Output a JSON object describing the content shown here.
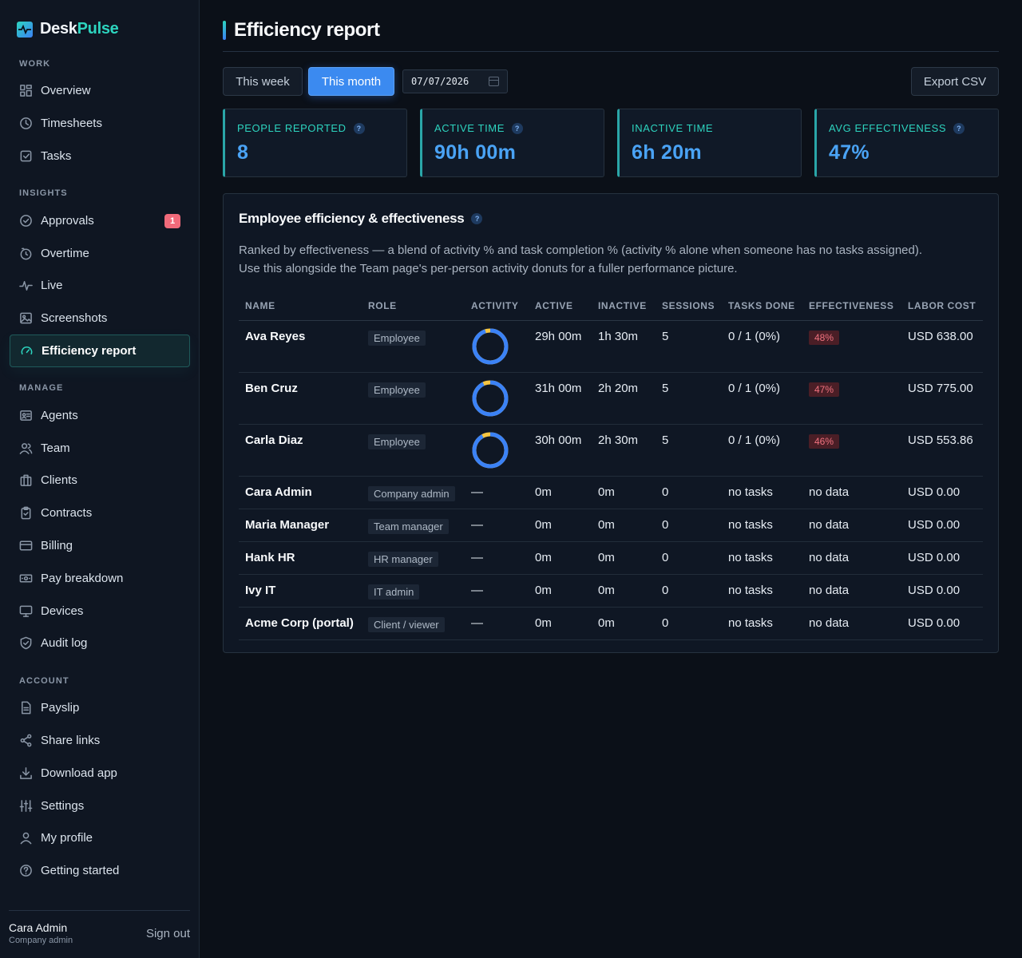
{
  "brand": {
    "part1": "Desk",
    "part2": "Pulse"
  },
  "sidebar": {
    "sections": {
      "work": "WORK",
      "insights": "INSIGHTS",
      "manage": "MANAGE",
      "account": "ACCOUNT"
    },
    "items": {
      "overview": "Overview",
      "timesheets": "Timesheets",
      "tasks": "Tasks",
      "approvals": "Approvals",
      "approvals_badge": "1",
      "overtime": "Overtime",
      "live": "Live",
      "screenshots": "Screenshots",
      "efficiency": "Efficiency report",
      "agents": "Agents",
      "team": "Team",
      "clients": "Clients",
      "contracts": "Contracts",
      "billing": "Billing",
      "pay_breakdown": "Pay breakdown",
      "devices": "Devices",
      "audit_log": "Audit log",
      "payslip": "Payslip",
      "share_links": "Share links",
      "download_app": "Download app",
      "settings": "Settings",
      "my_profile": "My profile",
      "getting_started": "Getting started"
    },
    "user": {
      "name": "Cara Admin",
      "role": "Company admin",
      "sign_out": "Sign out"
    }
  },
  "header": {
    "title": "Efficiency report"
  },
  "controls": {
    "this_week": "This week",
    "this_month": "This month",
    "date": "07/07/2026",
    "export": "Export CSV"
  },
  "kpis": {
    "people": {
      "label": "PEOPLE REPORTED",
      "value": "8"
    },
    "active": {
      "label": "ACTIVE TIME",
      "value": "90h 00m"
    },
    "inactive": {
      "label": "INACTIVE TIME",
      "value": "6h 20m"
    },
    "avg": {
      "label": "AVG EFFECTIVENESS",
      "value": "47%"
    }
  },
  "help_glyph": "?",
  "card": {
    "title": "Employee efficiency & effectiveness",
    "desc1": "Ranked by effectiveness — a blend of activity % and task completion % (activity % alone when someone has no tasks assigned).",
    "desc2": "Use this alongside the Team page's per-person activity donuts for a fuller performance picture."
  },
  "table": {
    "headers": [
      "NAME",
      "ROLE",
      "ACTIVITY",
      "ACTIVE",
      "INACTIVE",
      "SESSIONS",
      "TASKS DONE",
      "EFFECTIVENESS",
      "LABOR COST"
    ],
    "rows": [
      {
        "name": "Ava Reyes",
        "role": "Employee",
        "activity_pct": 95,
        "activity": "",
        "active": "29h 00m",
        "inactive": "1h 30m",
        "sessions": "5",
        "tasks": "0 / 1 (0%)",
        "eff": "48%",
        "cost": "USD 638.00"
      },
      {
        "name": "Ben Cruz",
        "role": "Employee",
        "activity_pct": 93,
        "activity": "",
        "active": "31h 00m",
        "inactive": "2h 20m",
        "sessions": "5",
        "tasks": "0 / 1 (0%)",
        "eff": "47%",
        "cost": "USD 775.00"
      },
      {
        "name": "Carla Diaz",
        "role": "Employee",
        "activity_pct": 92,
        "activity": "",
        "active": "30h 00m",
        "inactive": "2h 30m",
        "sessions": "5",
        "tasks": "0 / 1 (0%)",
        "eff": "46%",
        "cost": "USD 553.86"
      },
      {
        "name": "Cara Admin",
        "role": "Company admin",
        "activity": "—",
        "active": "0m",
        "inactive": "0m",
        "sessions": "0",
        "tasks": "no tasks",
        "eff": "no data",
        "cost": "USD 0.00"
      },
      {
        "name": "Maria Manager",
        "role": "Team manager",
        "activity": "—",
        "active": "0m",
        "inactive": "0m",
        "sessions": "0",
        "tasks": "no tasks",
        "eff": "no data",
        "cost": "USD 0.00"
      },
      {
        "name": "Hank HR",
        "role": "HR manager",
        "activity": "—",
        "active": "0m",
        "inactive": "0m",
        "sessions": "0",
        "tasks": "no tasks",
        "eff": "no data",
        "cost": "USD 0.00"
      },
      {
        "name": "Ivy IT",
        "role": "IT admin",
        "activity": "—",
        "active": "0m",
        "inactive": "0m",
        "sessions": "0",
        "tasks": "no tasks",
        "eff": "no data",
        "cost": "USD 0.00"
      },
      {
        "name": "Acme Corp (portal)",
        "role": "Client / viewer",
        "activity": "—",
        "active": "0m",
        "inactive": "0m",
        "sessions": "0",
        "tasks": "no tasks",
        "eff": "no data",
        "cost": "USD 0.00"
      }
    ]
  },
  "colors": {
    "accent_teal": "#2dd4bf",
    "accent_blue": "#3b82f6",
    "donut_active": "#3b82f6",
    "donut_inactive": "#f5c542",
    "danger": "#f0727f"
  }
}
